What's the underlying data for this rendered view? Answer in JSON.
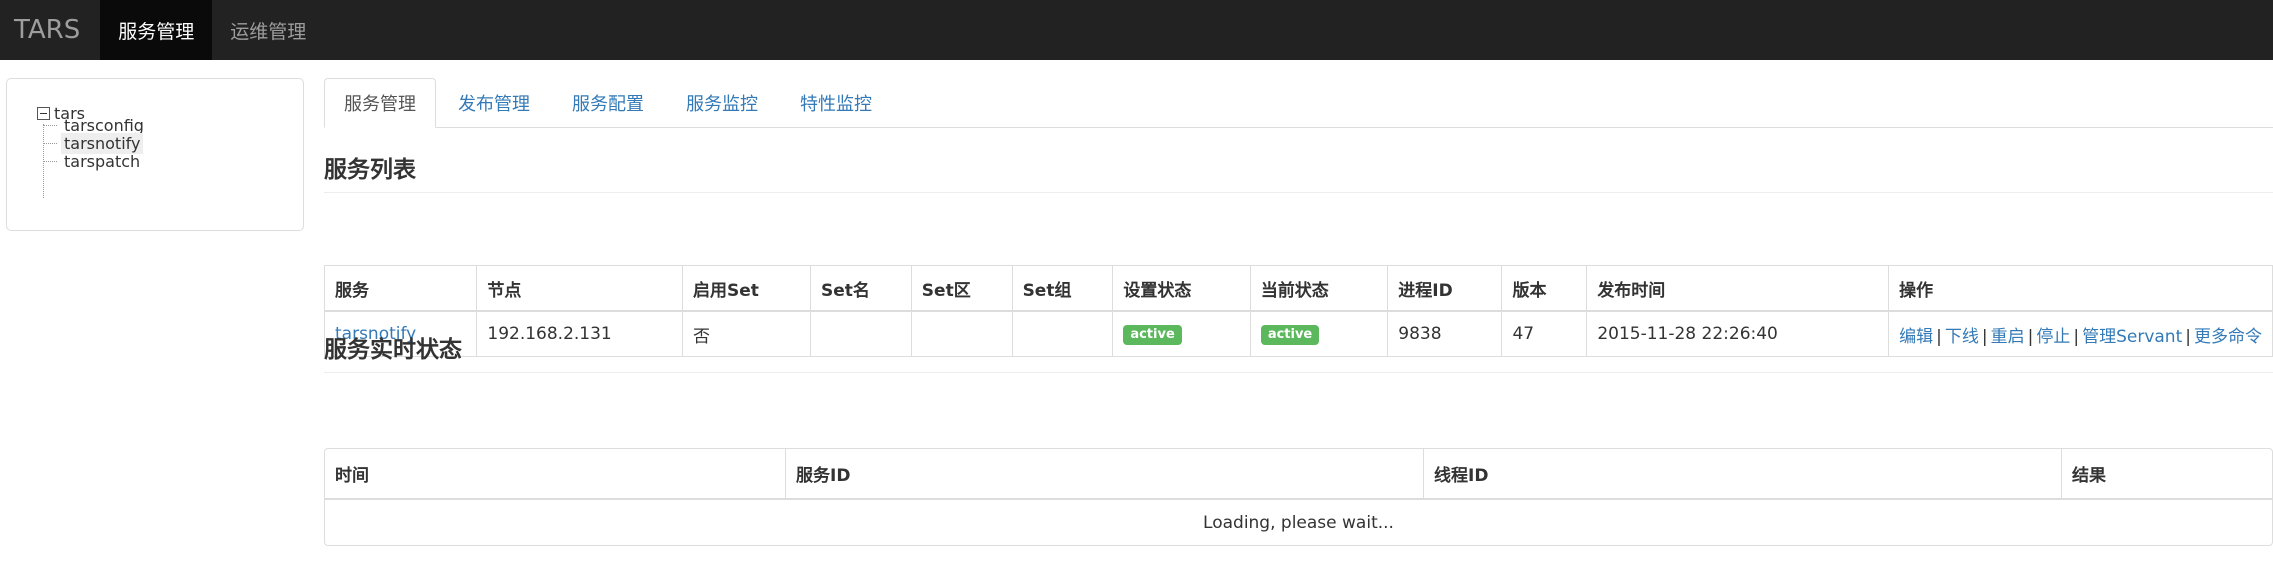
{
  "navbar": {
    "brand": "TARS",
    "items": [
      {
        "label": "服务管理",
        "active": true
      },
      {
        "label": "运维管理",
        "active": false
      }
    ]
  },
  "tree": {
    "root": "tars",
    "children": [
      {
        "label": "tarsconfig",
        "selected": false
      },
      {
        "label": "tarsnotify",
        "selected": true
      },
      {
        "label": "tarspatch",
        "selected": false
      }
    ]
  },
  "tabs": [
    {
      "label": "服务管理",
      "active": true
    },
    {
      "label": "发布管理",
      "active": false
    },
    {
      "label": "服务配置",
      "active": false
    },
    {
      "label": "服务监控",
      "active": false
    },
    {
      "label": "特性监控",
      "active": false
    }
  ],
  "service_list": {
    "title": "服务列表",
    "columns": [
      "服务",
      "节点",
      "启用Set",
      "Set名",
      "Set区",
      "Set组",
      "设置状态",
      "当前状态",
      "进程ID",
      "版本",
      "发布时间",
      "操作"
    ],
    "rows": [
      {
        "service": "tarsnotify",
        "node": "192.168.2.131",
        "enable_set": "否",
        "set_name": "",
        "set_area": "",
        "set_group": "",
        "setting_state": "active",
        "present_state": "active",
        "pid": "9838",
        "version": "47",
        "publish_time": "2015-11-28 22:26:40",
        "actions": [
          "编辑",
          "下线",
          "重启",
          "停止",
          "管理Servant",
          "更多命令"
        ]
      }
    ]
  },
  "realtime": {
    "title": "服务实时状态",
    "columns": [
      "时间",
      "服务ID",
      "线程ID",
      "结果"
    ],
    "loading_text": "Loading, please wait..."
  },
  "colors": {
    "navbar_bg": "#222222",
    "link": "#337ab7",
    "badge_success": "#5cb85c"
  }
}
